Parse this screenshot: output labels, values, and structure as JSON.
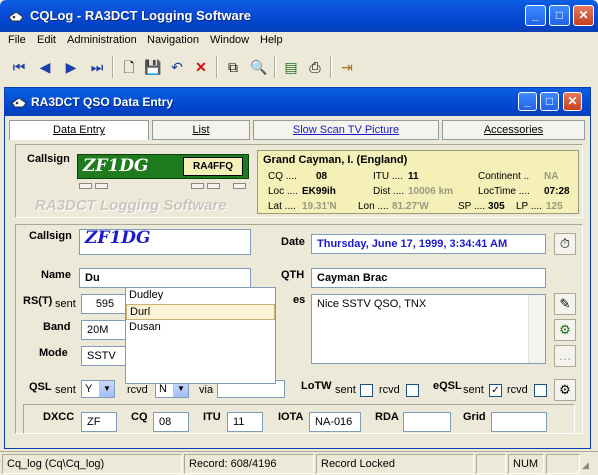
{
  "app": {
    "title": "CQLog - RA3DCT Logging Software"
  },
  "menu": [
    "File",
    "Edit",
    "Administration",
    "Navigation",
    "Window",
    "Help"
  ],
  "child": {
    "title": "RA3DCT QSO Data Entry"
  },
  "tabs": [
    "Data Entry",
    "List",
    "Slow Scan TV Picture",
    "Accessories"
  ],
  "header": {
    "callsign_label": "Callsign",
    "callsign": "ZF1DG",
    "operator_call": "RA4FFQ",
    "watermark": "RA3DCT Logging Software",
    "country": "Grand Cayman, I. (England)",
    "cq_label": "CQ ....",
    "cq": "08",
    "itu_label": "ITU ....",
    "itu": "11",
    "continent_label": "Continent ..",
    "continent": "NA",
    "loc_label": "Loc ....",
    "loc": "EK99ih",
    "dist_label": "Dist ....",
    "dist": "10006 km",
    "loctime_label": "LocTime ....",
    "loctime": "07:28",
    "lat_label": "Lat ....",
    "lat": "19.31'N",
    "lon_label": "Lon ....",
    "lon": "81.27'W",
    "sp_label": "SP ....",
    "sp": "305",
    "lp_label": "LP ....",
    "lp": "125"
  },
  "form": {
    "callsign_label": "Callsign",
    "callsign": "ZF1DG",
    "date_label": "Date",
    "date": "Thursday, June 17, 1999, 3:34:41 AM",
    "name_label": "Name",
    "name": "Du",
    "qth_label": "QTH",
    "qth": "Cayman Brac",
    "rst_label": "RS(T)",
    "sent_label": "sent",
    "rst_sent": "595",
    "notes_label": "es",
    "notes": "Nice SSTV QSO, TNX",
    "band_label": "Band",
    "band": "20M",
    "mode_label": "Mode",
    "mode": "SSTV",
    "qsl_label": "QSL",
    "qsl_sent_label": "sent",
    "qsl_sent": "Y",
    "qsl_rcvd_label": "rcvd",
    "qsl_rcvd": "N",
    "qsl_via_label": "via",
    "lotw_label": "LoTW",
    "lotw_sent_label": "sent",
    "lotw_rcvd_label": "rcvd",
    "eqsl_label": "eQSL",
    "eqsl_sent_label": "sent",
    "eqsl_rcvd_label": "rcvd",
    "dxcc_label": "DXCC",
    "dxcc": "ZF",
    "cq_label": "CQ",
    "cq": "08",
    "itu_label": "ITU",
    "itu": "11",
    "iota_label": "IOTA",
    "iota": "NA-016",
    "rda_label": "RDA",
    "rda": "",
    "grid_label": "Grid",
    "grid": ""
  },
  "autocomplete": [
    "Dudley",
    "Durl",
    "Dusan"
  ],
  "statusbar": {
    "db": "Cq_log (Cq\\Cq_log)",
    "record": "Record: 608/4196",
    "locked": "Record Locked",
    "num": "NUM"
  },
  "colors": {
    "accent": "#0042C8",
    "green": "#1E7B1E",
    "info_bg": "#F5EFB8",
    "date_text": "#1A1AC8"
  }
}
